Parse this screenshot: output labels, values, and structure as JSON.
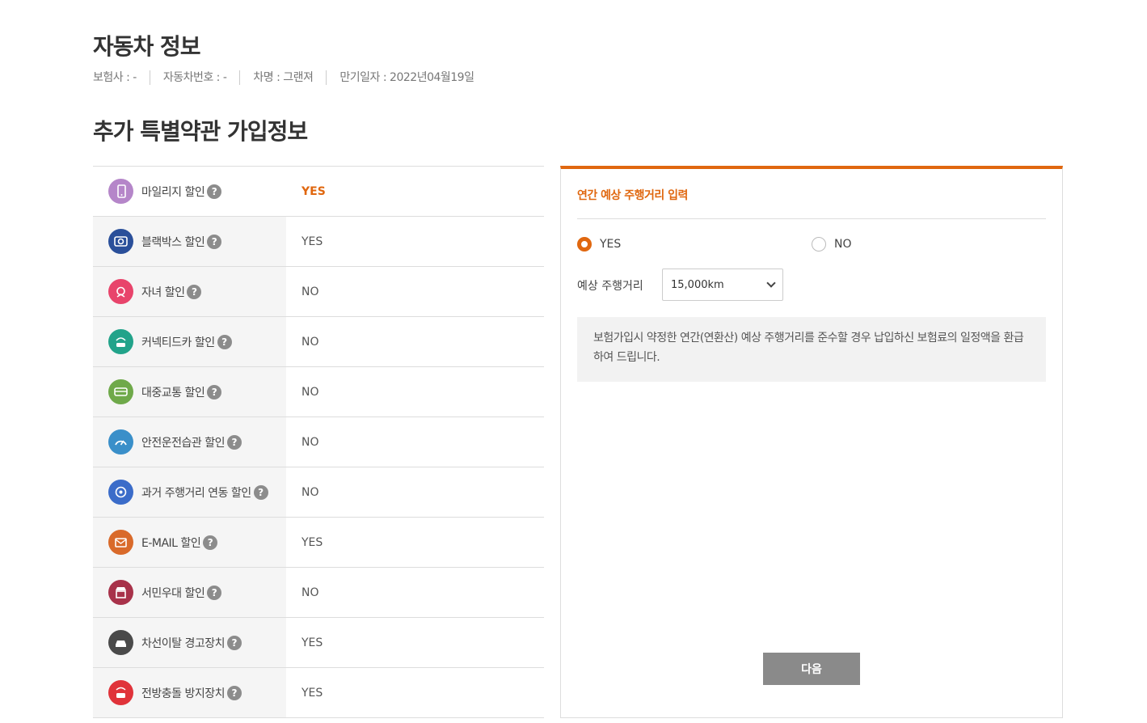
{
  "header": {
    "title": "자동차 정보",
    "info": [
      "보험사 : -",
      "자동차번호 : -",
      "차명 : 그랜져",
      "만기일자 : 2022년04월19일"
    ]
  },
  "section": {
    "title": "추가 특별약관 가입정보"
  },
  "options": [
    {
      "label": "마일리지 할인",
      "value": "YES",
      "icon": "mileage-phone-icon",
      "color": "#b586c9"
    },
    {
      "label": "블랙박스 할인",
      "value": "YES",
      "icon": "blackbox-camera-icon",
      "color": "#2a4f9a"
    },
    {
      "label": "자녀 할인",
      "value": "NO",
      "icon": "child-icon",
      "color": "#e8446b"
    },
    {
      "label": "커넥티드카 할인",
      "value": "NO",
      "icon": "connected-car-icon",
      "color": "#22a38a"
    },
    {
      "label": "대중교통 할인",
      "value": "NO",
      "icon": "bus-icon",
      "color": "#6fa94a"
    },
    {
      "label": "안전운전습관 할인",
      "value": "NO",
      "icon": "speedometer-icon",
      "color": "#3a8fc9"
    },
    {
      "label": "과거 주행거리 연동 할인",
      "value": "NO",
      "icon": "distance-icon",
      "color": "#3b6cc9"
    },
    {
      "label": "E-MAIL 할인",
      "value": "YES",
      "icon": "email-icon",
      "color": "#d96a2a"
    },
    {
      "label": "서민우대 할인",
      "value": "NO",
      "icon": "shop-icon",
      "color": "#a8324a"
    },
    {
      "label": "차선이탈 경고장치",
      "value": "YES",
      "icon": "lane-warning-car-icon",
      "color": "#4a4a4a"
    },
    {
      "label": "전방충돌 방지장치",
      "value": "YES",
      "icon": "collision-warning-car-icon",
      "color": "#e0333a"
    }
  ],
  "help_glyph": "?",
  "panel": {
    "title": "연간 예상 주행거리 입력",
    "radio_yes": "YES",
    "radio_no": "NO",
    "selected": "YES",
    "distance_label": "예상 주행거리",
    "distance_value": "15,000km",
    "notice": "보험가입시 약정한 연간(연환산) 예상 주행거리를 준수할 경우 납입하신 보험료의 일정액을 환급하여 드립니다.",
    "next_button": "다음"
  },
  "colors": {
    "accent": "#e0670f",
    "button": "#8a8a8a"
  }
}
